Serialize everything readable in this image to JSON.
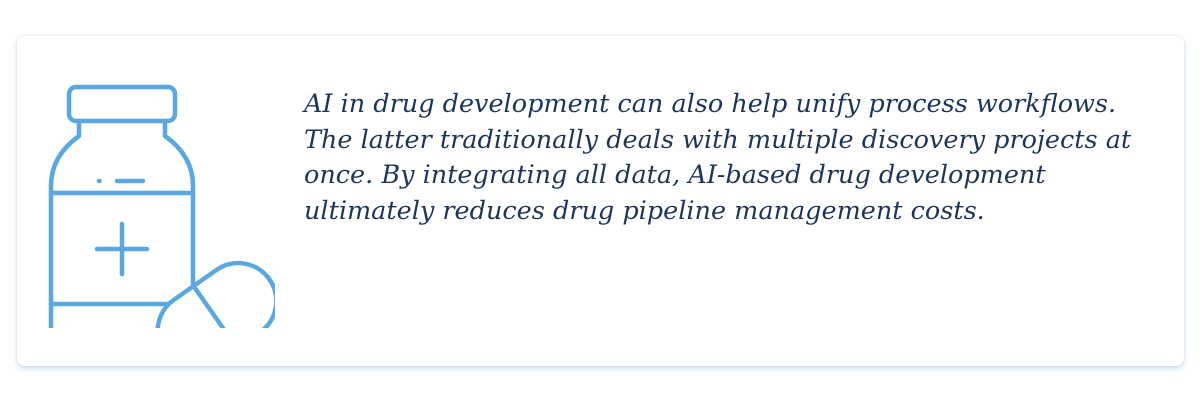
{
  "card": {
    "icon": "medicine-bottle-and-capsule-icon",
    "icon_color": "#5aa8df",
    "text": "AI in drug development can also help unify process workflows. The latter traditionally deals with multiple discovery projects at once. By integrating all data, AI-based drug development ultimately reduces drug pipeline management costs.",
    "text_color": "#1d3557"
  }
}
